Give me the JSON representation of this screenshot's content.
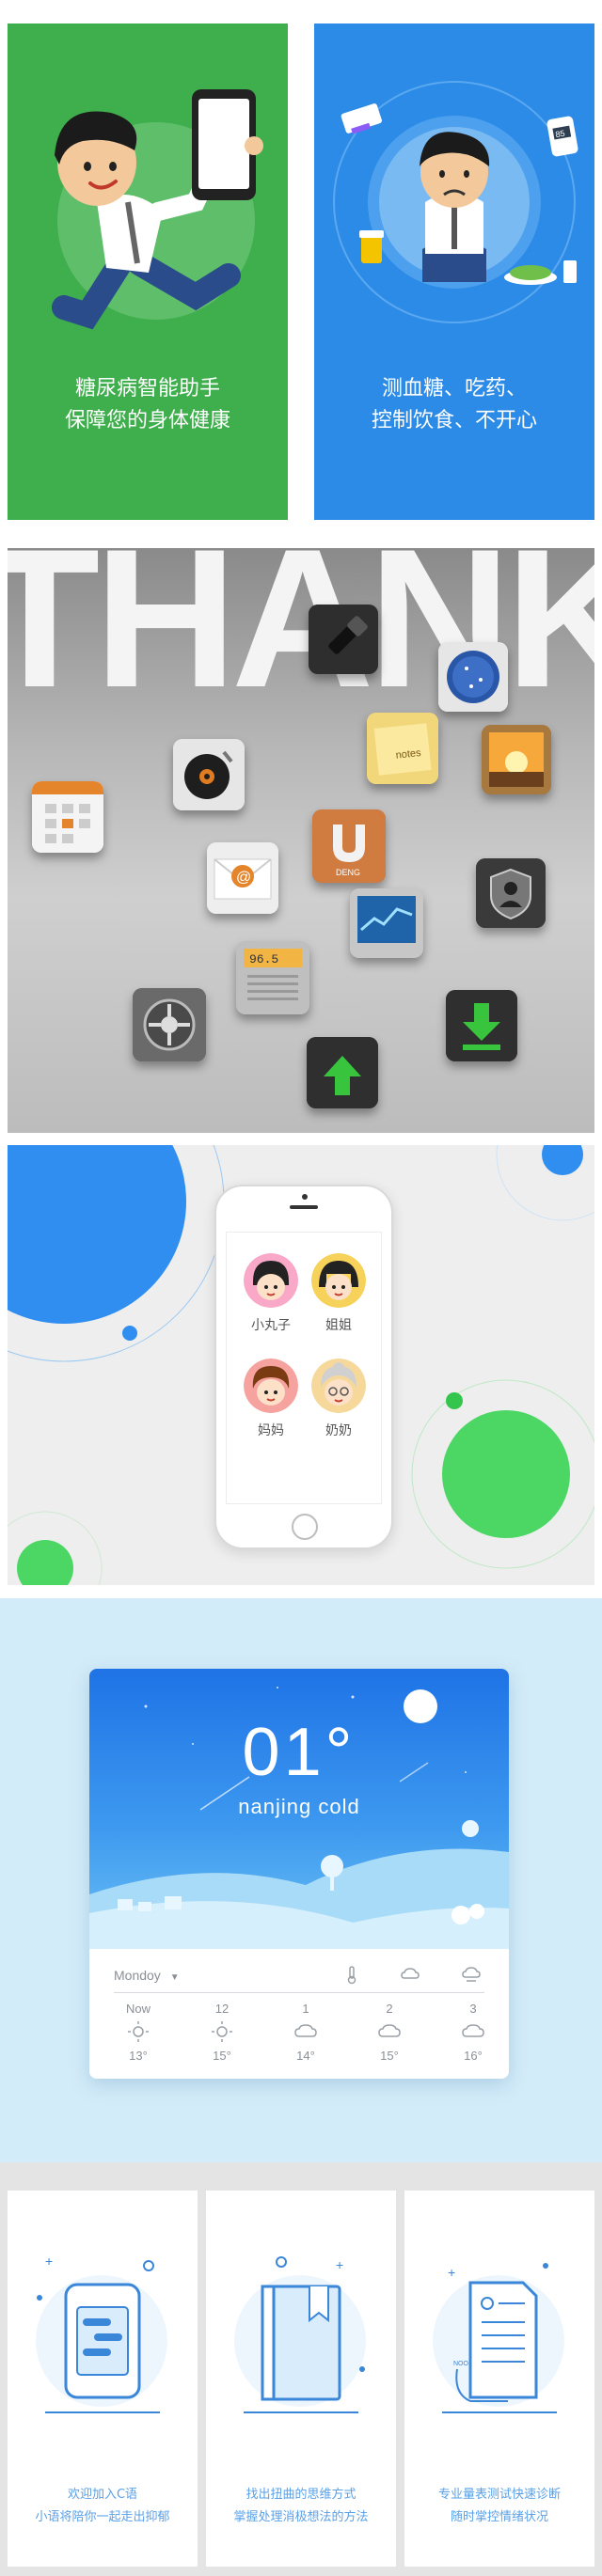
{
  "diabetes": {
    "card_left": {
      "line1": "糖尿病智能助手",
      "line2": "保障您的身体健康",
      "color": "#3fae4c"
    },
    "card_right": {
      "line1": "测血糖、吃药、",
      "line2": "控制饮食、不开心",
      "color": "#2c8be6",
      "meter_reading": "85"
    }
  },
  "thanks": {
    "word": "THANKS",
    "notes_label": "notes",
    "radio_display": "96.5",
    "uncle_label": "DENG",
    "icons": [
      "flashlight-icon",
      "compass-icon",
      "notes-icon",
      "photo-icon",
      "music-icon",
      "calendar-icon",
      "mail-icon",
      "magnet-icon",
      "stocks-icon",
      "contacts-icon",
      "radio-icon",
      "settings-icon",
      "download-icon",
      "upload-icon"
    ]
  },
  "family": {
    "members": [
      {
        "name": "小丸子"
      },
      {
        "name": "姐姐"
      },
      {
        "name": "妈妈"
      },
      {
        "name": "奶奶"
      }
    ]
  },
  "weather": {
    "temperature": "01°",
    "city": "nanjing cold",
    "day": "Mondoy",
    "forecast": [
      {
        "time": "Now",
        "icon": "sun-icon",
        "temp": "13°"
      },
      {
        "time": "12",
        "icon": "sun-icon",
        "temp": "15°"
      },
      {
        "time": "1",
        "icon": "cloud-icon",
        "temp": "14°"
      },
      {
        "time": "2",
        "icon": "cloud-icon",
        "temp": "15°"
      },
      {
        "time": "3",
        "icon": "cloud-icon",
        "temp": "16°"
      }
    ]
  },
  "onboarding": {
    "cards": [
      {
        "line1": "欢迎加入C语",
        "line2": "小语将陪你一起走出抑郁"
      },
      {
        "line1": "找出扭曲的思维方式",
        "line2": "掌握处理消极想法的方法"
      },
      {
        "line1": "专业量表测试快速诊断",
        "line2": "随时掌控情绪状况",
        "doc_label": "NOO"
      }
    ]
  }
}
